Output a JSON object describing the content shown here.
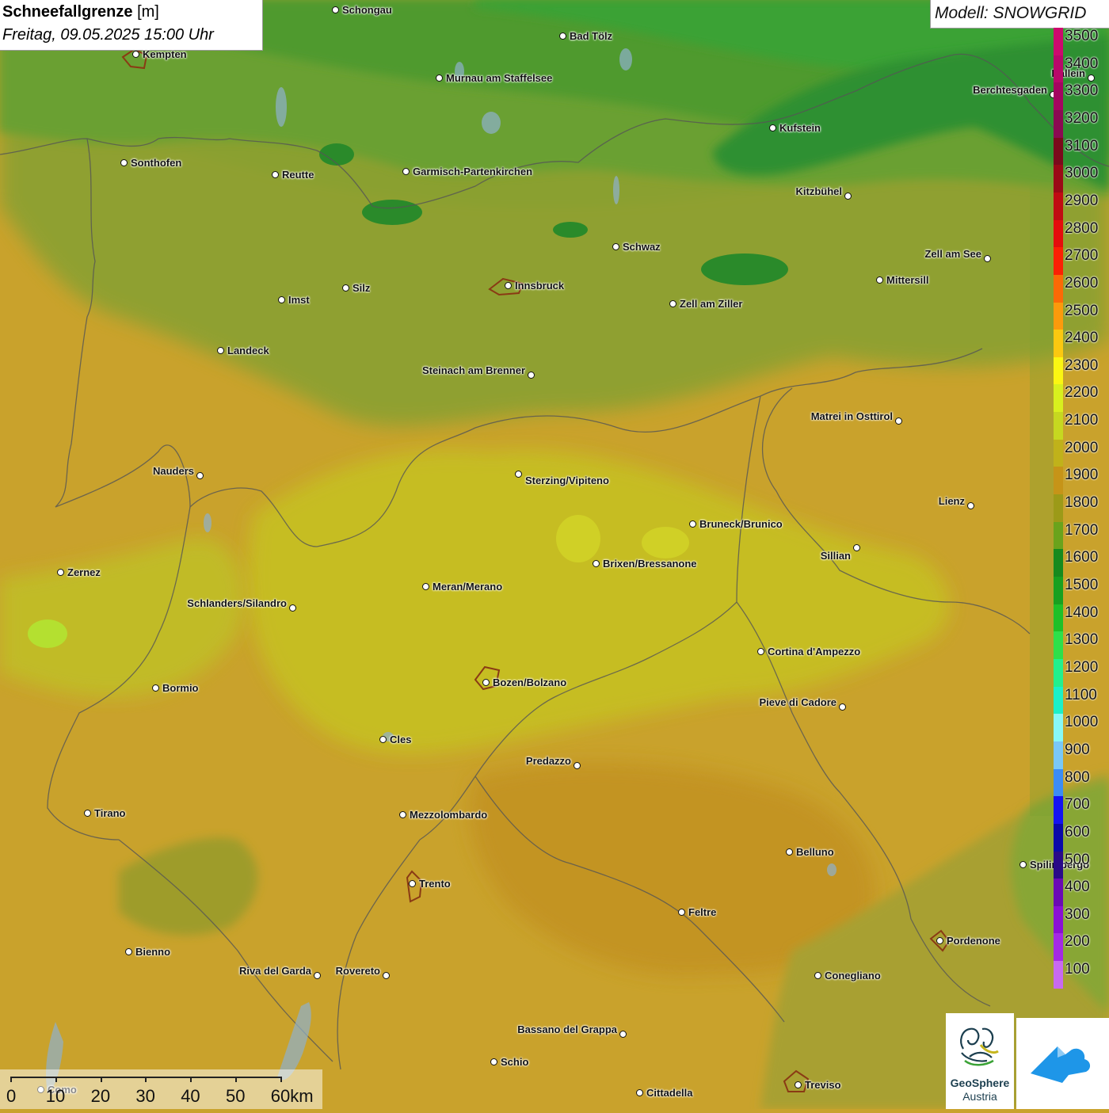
{
  "header": {
    "title_bold": "Schneefallgrenze",
    "title_unit": "[m]",
    "datetime": "Freitag, 09.05.2025 15:00 Uhr"
  },
  "model": {
    "label": "Modell: SNOWGRID"
  },
  "legend": [
    {
      "label": "3500",
      "color": "#cc0a6e"
    },
    {
      "label": "3400",
      "color": "#b8086a"
    },
    {
      "label": "3300",
      "color": "#a30560"
    },
    {
      "label": "3200",
      "color": "#8a0a52"
    },
    {
      "label": "3100",
      "color": "#7a0a1c"
    },
    {
      "label": "3000",
      "color": "#9a0a16"
    },
    {
      "label": "2900",
      "color": "#c00c12"
    },
    {
      "label": "2800",
      "color": "#e40c0c"
    },
    {
      "label": "2700",
      "color": "#fb2004"
    },
    {
      "label": "2600",
      "color": "#fb6a06"
    },
    {
      "label": "2500",
      "color": "#fb9a0c"
    },
    {
      "label": "2400",
      "color": "#fbc810"
    },
    {
      "label": "2300",
      "color": "#fbf612"
    },
    {
      "label": "2200",
      "color": "#d8f01e"
    },
    {
      "label": "2100",
      "color": "#c6d820"
    },
    {
      "label": "2000",
      "color": "#c0b21a"
    },
    {
      "label": "1900",
      "color": "#c69418"
    },
    {
      "label": "1800",
      "color": "#9c9a18"
    },
    {
      "label": "1700",
      "color": "#6aa31c"
    },
    {
      "label": "1600",
      "color": "#168a1e"
    },
    {
      "label": "1500",
      "color": "#18a020"
    },
    {
      "label": "1400",
      "color": "#1ec028"
    },
    {
      "label": "1300",
      "color": "#2ee04a"
    },
    {
      "label": "1200",
      "color": "#22f08e"
    },
    {
      "label": "1100",
      "color": "#1cf0c8"
    },
    {
      "label": "1000",
      "color": "#88f8f6"
    },
    {
      "label": "900",
      "color": "#7ac8f6"
    },
    {
      "label": "800",
      "color": "#3c8cf4"
    },
    {
      "label": "700",
      "color": "#1414f0"
    },
    {
      "label": "600",
      "color": "#0a0aa8"
    },
    {
      "label": "500",
      "color": "#2a0a88"
    },
    {
      "label": "400",
      "color": "#6a0ab4"
    },
    {
      "label": "300",
      "color": "#8a10d4"
    },
    {
      "label": "200",
      "color": "#a42ae4"
    },
    {
      "label": "100",
      "color": "#c86af0"
    }
  ],
  "cities": [
    {
      "name": "Schongau"
    },
    {
      "name": "Bad Tölz"
    },
    {
      "name": "Kempten"
    },
    {
      "name": "Murnau am Staffelsee"
    },
    {
      "name": "Berchtesgaden"
    },
    {
      "name": "Hallein"
    },
    {
      "name": "Kufstein"
    },
    {
      "name": "Sonthofen"
    },
    {
      "name": "Reutte"
    },
    {
      "name": "Garmisch-Partenkirchen"
    },
    {
      "name": "Kitzbühel"
    },
    {
      "name": "Schwaz"
    },
    {
      "name": "Zell am See"
    },
    {
      "name": "Mittersill"
    },
    {
      "name": "Innsbruck"
    },
    {
      "name": "Imst"
    },
    {
      "name": "Silz"
    },
    {
      "name": "Zell am Ziller"
    },
    {
      "name": "Landeck"
    },
    {
      "name": "Steinach am Brenner"
    },
    {
      "name": "Matrei in Osttirol"
    },
    {
      "name": "Nauders"
    },
    {
      "name": "Sterzing/Vipiteno"
    },
    {
      "name": "Lienz"
    },
    {
      "name": "Bruneck/Brunico"
    },
    {
      "name": "Sillian"
    },
    {
      "name": "Zernez"
    },
    {
      "name": "Brixen/Bressanone"
    },
    {
      "name": "Meran/Merano"
    },
    {
      "name": "Schlanders/Silandro"
    },
    {
      "name": "Cortina d'Ampezzo"
    },
    {
      "name": "Bozen/Bolzano"
    },
    {
      "name": "Bormio"
    },
    {
      "name": "Pieve di Cadore"
    },
    {
      "name": "Cles"
    },
    {
      "name": "Predazzo"
    },
    {
      "name": "Tirano"
    },
    {
      "name": "Mezzolombardo"
    },
    {
      "name": "Belluno"
    },
    {
      "name": "Spilimbergo"
    },
    {
      "name": "Trento"
    },
    {
      "name": "Feltre"
    },
    {
      "name": "Pordenone"
    },
    {
      "name": "Bienno"
    },
    {
      "name": "Riva del Garda"
    },
    {
      "name": "Rovereto"
    },
    {
      "name": "Conegliano"
    },
    {
      "name": "Bassano del Grappa"
    },
    {
      "name": "Schio"
    },
    {
      "name": "Treviso"
    },
    {
      "name": "Cittadella"
    },
    {
      "name": "Como"
    }
  ],
  "scale_bar": {
    "labels": [
      "0",
      "10",
      "20",
      "30",
      "40",
      "50",
      "60km"
    ]
  },
  "logos": {
    "geosphere_line1": "GeoSphere",
    "geosphere_line2": "Austria"
  }
}
